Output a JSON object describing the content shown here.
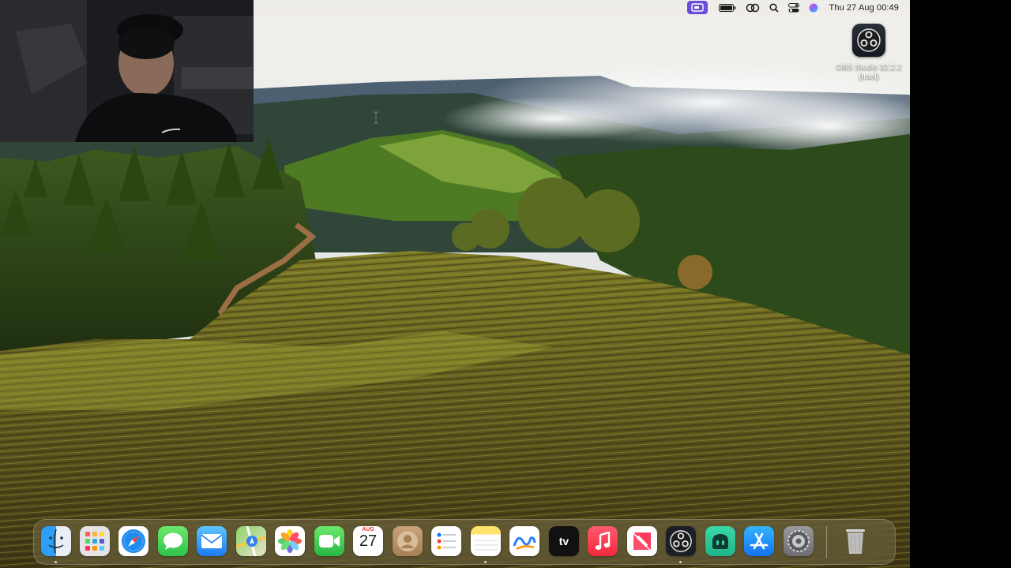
{
  "menubar": {
    "clock": "Thu 27 Aug  00:49",
    "items": [
      "screen-mirroring-icon",
      "battery-icon",
      "link-icon",
      "search-icon",
      "control-center-icon",
      "siri-icon"
    ]
  },
  "desktop": {
    "obs_icon_label": "OBS Studio 32.2.2\n(Intel)"
  },
  "dock": {
    "apps": [
      {
        "name": "Finder"
      },
      {
        "name": "Launchpad"
      },
      {
        "name": "Safari"
      },
      {
        "name": "Messages"
      },
      {
        "name": "Mail"
      },
      {
        "name": "Maps"
      },
      {
        "name": "Photos"
      },
      {
        "name": "FaceTime"
      },
      {
        "name": "Calendar"
      },
      {
        "name": "Contacts"
      },
      {
        "name": "Reminders"
      },
      {
        "name": "Notes"
      },
      {
        "name": "Freeform"
      },
      {
        "name": "TV"
      },
      {
        "name": "Music"
      },
      {
        "name": "News"
      },
      {
        "name": "OBS Studio"
      },
      {
        "name": "Copilot"
      },
      {
        "name": "App Store"
      },
      {
        "name": "System Settings"
      },
      {
        "name": "Trash"
      }
    ],
    "calendar_month": "AUG",
    "calendar_day": "27",
    "tv_label": "tv"
  },
  "colors": {
    "menubar_accent": "#6a4cd9",
    "sky": "#e8e9e6",
    "vineyard": "#6b6a1e"
  }
}
